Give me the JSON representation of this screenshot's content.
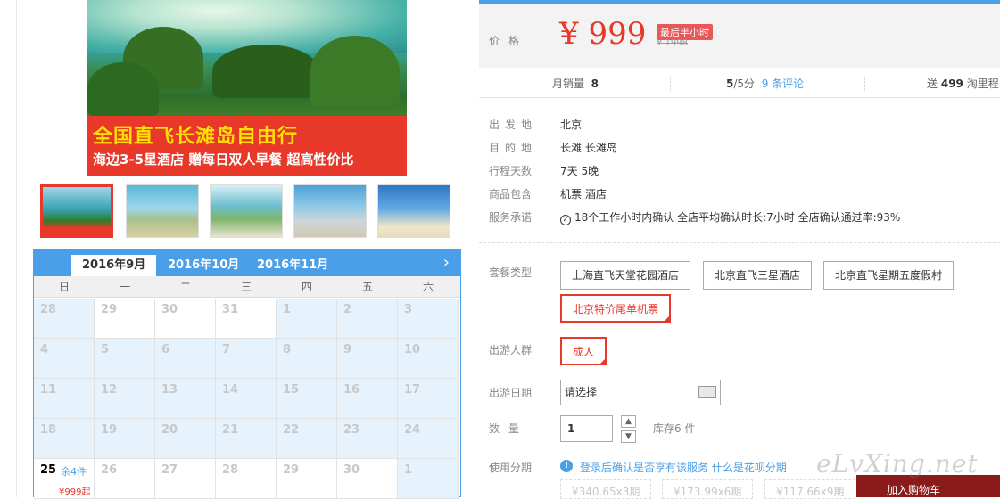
{
  "banner": {
    "line1": "全国直飞长滩岛自由行",
    "line2": "海边3-5星酒店 赠每日双人早餐 超高性价比"
  },
  "calendar": {
    "tabs": [
      "2016年9月",
      "2016年10月",
      "2016年11月"
    ],
    "weekdays": [
      "日",
      "一",
      "二",
      "三",
      "四",
      "五",
      "六"
    ],
    "next_icon": "chevron-right-icon",
    "rows": [
      [
        "28",
        "29",
        "30",
        "31",
        "1",
        "2",
        "3"
      ],
      [
        "4",
        "5",
        "6",
        "7",
        "8",
        "9",
        "10"
      ],
      [
        "11",
        "12",
        "13",
        "14",
        "15",
        "16",
        "17"
      ],
      [
        "18",
        "19",
        "20",
        "21",
        "22",
        "23",
        "24"
      ],
      [
        "25",
        "26",
        "27",
        "28",
        "29",
        "30",
        "1"
      ]
    ],
    "today": {
      "rest": "余4件",
      "price": "¥999起"
    }
  },
  "price": {
    "label": "价格",
    "value": "¥ 999",
    "badge": "最后半小时",
    "old": "¥ 1998"
  },
  "stats": {
    "monthly_label": "月销量",
    "monthly_value": "8",
    "rating_value": "5",
    "rating_suffix": "/5分",
    "reviews": "9 条评论",
    "points_prefix": "送",
    "points_value": "499",
    "points_suffix": "淘里程"
  },
  "info": [
    {
      "label": "出发地",
      "value": "北京"
    },
    {
      "label": "目的地",
      "value": "长滩  长滩岛"
    },
    {
      "label": "行程天数",
      "value": "7天 5晚"
    },
    {
      "label": "商品包含",
      "value": "机票  酒店"
    },
    {
      "label": "服务承诺",
      "value": "18个工作小时内确认    全店平均确认时长:7小时    全店确认通过率:93%"
    }
  ],
  "package": {
    "label": "套餐类型",
    "options": [
      "上海直飞天堂花园酒店",
      "北京直飞三星酒店",
      "北京直飞星期五度假村",
      "北京特价尾单机票"
    ]
  },
  "travelers": {
    "label": "出游人群",
    "option": "成人"
  },
  "date": {
    "label": "出游日期",
    "value": "请选择"
  },
  "quantity": {
    "label": "数量",
    "value": "1",
    "stock": "库存6 件"
  },
  "installment": {
    "label": "使用分期",
    "text": "登录后确认是否享有该服务",
    "link": "什么是花呗分期",
    "plans": [
      "¥340.65x3期",
      "¥173.99x6期",
      "¥117.66x9期"
    ]
  },
  "cart": {
    "label": "加入购物车"
  },
  "watermark": "eLvXing.net"
}
